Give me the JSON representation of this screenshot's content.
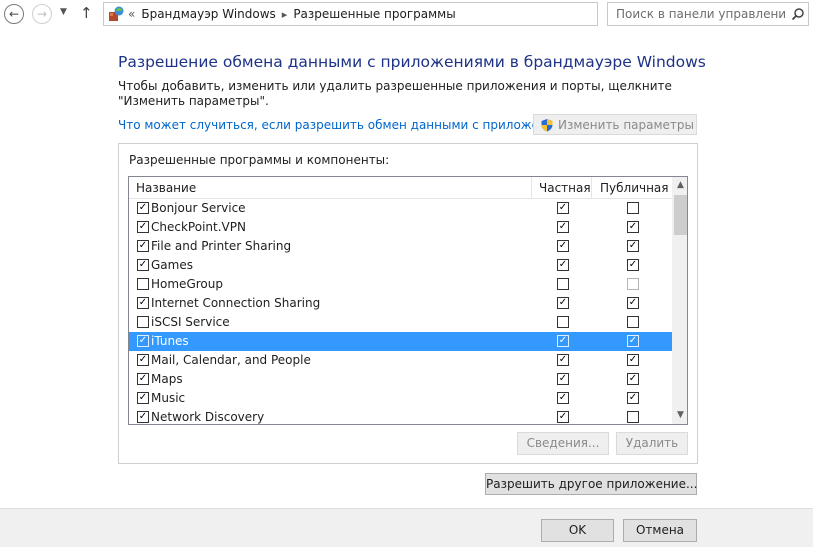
{
  "address_bar": {
    "overflow": "«",
    "crumbs": [
      "Брандмауэр Windows",
      "Разрешенные программы"
    ],
    "search_placeholder": "Поиск в панели управления"
  },
  "main": {
    "title": "Разрешение обмена данными с приложениями в брандмауэре Windows",
    "description": "Чтобы добавить, изменить или удалить разрешенные приложения и порты, щелкните \"Изменить параметры\".",
    "risk_link": "Что может случиться, если разрешить обмен данными с приложением?",
    "change_settings_button": "Изменить параметры"
  },
  "group": {
    "label": "Разрешенные программы и компоненты:",
    "columns": {
      "name": "Название",
      "private": "Частная",
      "public": "Публичная"
    },
    "rows": [
      {
        "name": "Bonjour Service",
        "enabled": true,
        "private": true,
        "public": false
      },
      {
        "name": "CheckPoint.VPN",
        "enabled": true,
        "private": true,
        "public": true
      },
      {
        "name": "File and Printer Sharing",
        "enabled": true,
        "private": true,
        "public": true
      },
      {
        "name": "Games",
        "enabled": true,
        "private": true,
        "public": true
      },
      {
        "name": "HomeGroup",
        "enabled": false,
        "private": false,
        "public": false,
        "public_disabled": true
      },
      {
        "name": "Internet Connection Sharing",
        "enabled": true,
        "private": true,
        "public": true
      },
      {
        "name": "iSCSI Service",
        "enabled": false,
        "private": false,
        "public": false
      },
      {
        "name": "iTunes",
        "enabled": true,
        "private": true,
        "public": true,
        "selected": true
      },
      {
        "name": "Mail, Calendar, and People",
        "enabled": true,
        "private": true,
        "public": true
      },
      {
        "name": "Maps",
        "enabled": true,
        "private": true,
        "public": true
      },
      {
        "name": "Music",
        "enabled": true,
        "private": true,
        "public": true
      },
      {
        "name": "Network Discovery",
        "enabled": true,
        "private": true,
        "public": false
      }
    ],
    "details_button": "Сведения...",
    "remove_button": "Удалить"
  },
  "allow_other_button": "Разрешить другое приложение...",
  "footer": {
    "ok": "OK",
    "cancel": "Отмена"
  },
  "colors": {
    "title": "#1e3287",
    "link": "#0066cc",
    "selection": "#3399ff"
  }
}
